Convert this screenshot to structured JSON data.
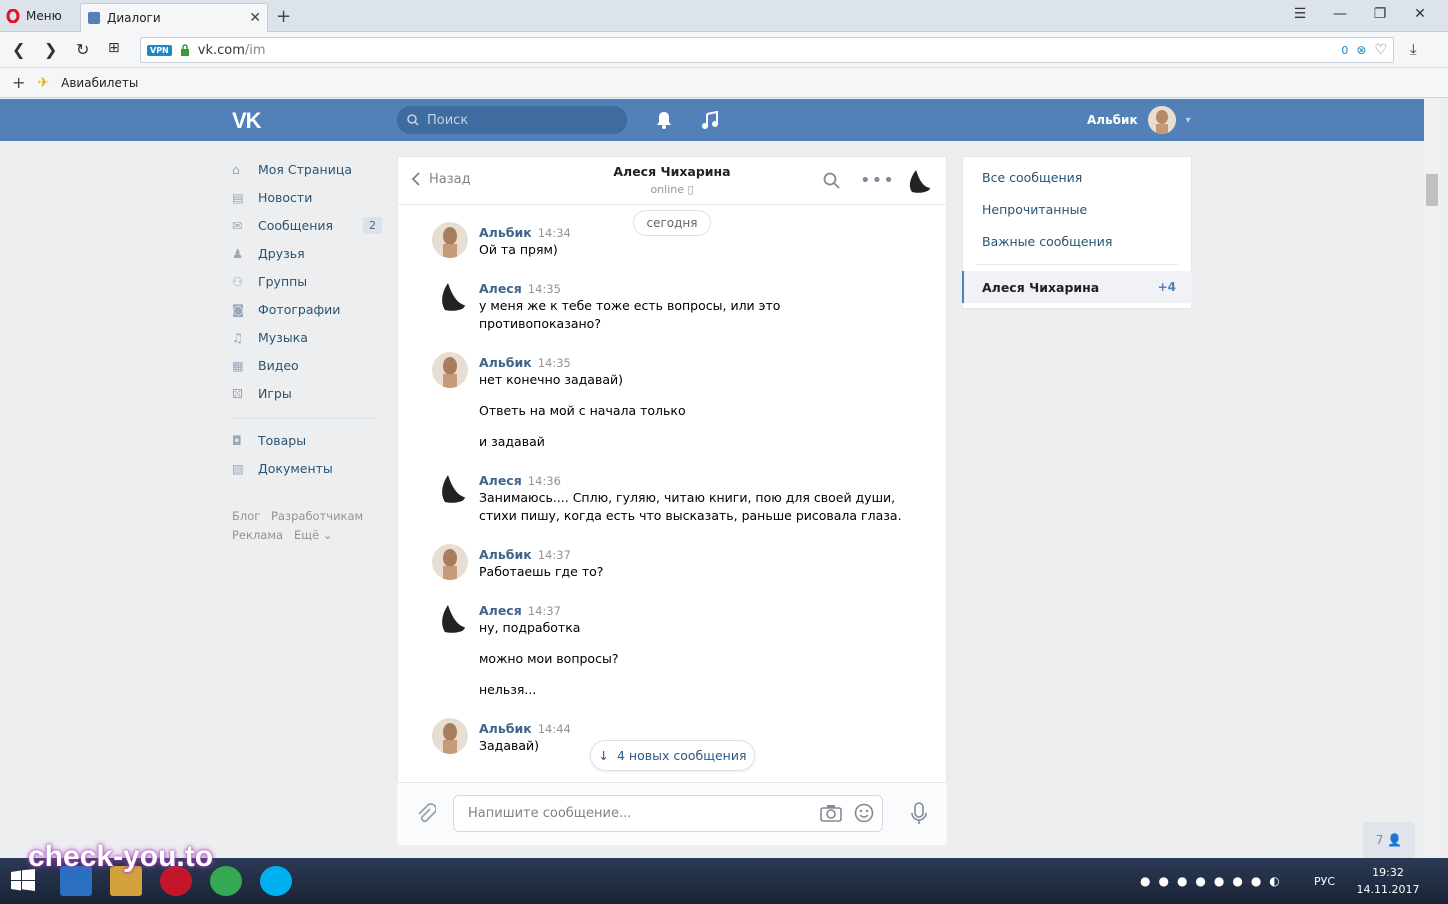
{
  "browser": {
    "menu_label": "Меню",
    "tab_title": "Диалоги",
    "url_domain": "vk.com",
    "url_path": "/im",
    "vpn_label": "VPN",
    "adblock_count": "0",
    "bookmark": "Авиабилеты"
  },
  "header": {
    "search_placeholder": "Поиск",
    "user_name": "Альбик"
  },
  "nav": {
    "items": [
      {
        "label": "Моя Страница",
        "icon": "home-icon"
      },
      {
        "label": "Новости",
        "icon": "news-icon"
      },
      {
        "label": "Сообщения",
        "icon": "messages-icon",
        "badge": "2"
      },
      {
        "label": "Друзья",
        "icon": "friends-icon"
      },
      {
        "label": "Группы",
        "icon": "groups-icon"
      },
      {
        "label": "Фотографии",
        "icon": "photos-icon"
      },
      {
        "label": "Музыка",
        "icon": "music-icon"
      },
      {
        "label": "Видео",
        "icon": "video-icon"
      },
      {
        "label": "Игры",
        "icon": "games-icon"
      }
    ],
    "items2": [
      {
        "label": "Товары",
        "icon": "market-icon"
      },
      {
        "label": "Документы",
        "icon": "docs-icon"
      }
    ],
    "footer": [
      "Блог",
      "Разработчикам",
      "Реклама",
      "Ещё"
    ]
  },
  "chat": {
    "back_label": "Назад",
    "contact_name": "Алеся Чихарина",
    "contact_status": "online",
    "date_divider": "сегодня",
    "messages": [
      {
        "author": "Альбик",
        "time": "14:34",
        "lines": [
          "Ой та прям)"
        ]
      },
      {
        "author": "Алеся",
        "time": "14:35",
        "lines": [
          "у меня же к тебе тоже есть вопросы, или это",
          "противопоказано?"
        ]
      },
      {
        "author": "Альбик",
        "time": "14:35",
        "lines": [
          "нет конечно задавай)",
          "Ответь на мой с начала только",
          "и задавай"
        ]
      },
      {
        "author": "Алеся",
        "time": "14:36",
        "lines": [
          "Занимаюсь.... Сплю, гуляю, читаю книги, пою для своей души,",
          "стихи пишу, когда есть что высказать, раньше рисовала глаза."
        ]
      },
      {
        "author": "Альбик",
        "time": "14:37",
        "lines": [
          "Работаешь где то?"
        ]
      },
      {
        "author": "Алеся",
        "time": "14:37",
        "lines": [
          "ну, подработка",
          "можно мои вопросы?",
          "нельзя..."
        ]
      },
      {
        "author": "Альбик",
        "time": "14:44",
        "lines": [
          "Задавай)"
        ]
      }
    ],
    "new_messages_label": "4 новых сообщения",
    "input_placeholder": "Напишите сообщение..."
  },
  "right": {
    "links": [
      "Все сообщения",
      "Непрочитанные",
      "Важные сообщения"
    ],
    "selected_dialog": "Алеся Чихарина",
    "selected_count": "+4"
  },
  "online_friends_count": "7",
  "taskbar": {
    "watermark": "check-you.to",
    "lang": "РУС",
    "time": "19:32",
    "date": "14.11.2017"
  },
  "colors": {
    "vk_blue": "#5181b8",
    "link": "#285473",
    "author": "#42648b"
  }
}
